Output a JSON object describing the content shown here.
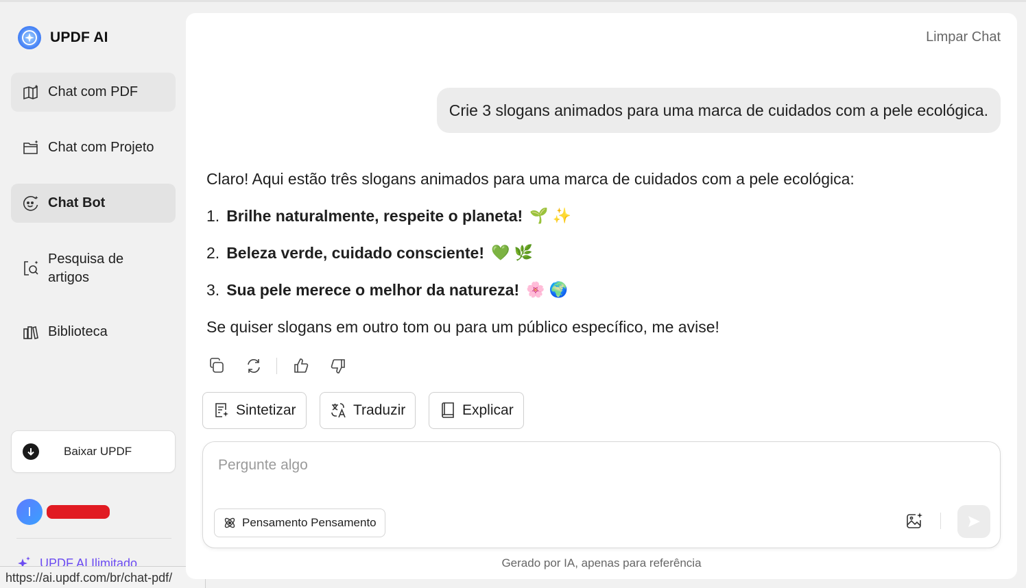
{
  "brand": {
    "name": "UPDF AI"
  },
  "sidebar": {
    "items": [
      {
        "label": "Chat com PDF",
        "icon": "book-sparkle-icon"
      },
      {
        "label": "Chat com Projeto",
        "icon": "folder-sparkle-icon"
      },
      {
        "label": "Chat Bot",
        "icon": "bot-face-icon"
      },
      {
        "label": "Pesquisa de",
        "label2": "artigos",
        "icon": "search-document-icon"
      },
      {
        "label": "Biblioteca",
        "icon": "library-icon"
      }
    ],
    "download_label": "Baixar UPDF",
    "user_initial": "I",
    "unlimited_label": "UPDF AI Ilimitado"
  },
  "status_url": "https://ai.updf.com/br/chat-pdf/",
  "chat": {
    "clear_label": "Limpar Chat",
    "user_message": "Crie 3 slogans animados para uma marca de cuidados com a pele ecológica.",
    "answer_intro": "Claro! Aqui estão três slogans animados para uma marca de cuidados com a pele ecológica:",
    "slogans": [
      {
        "num": "1.",
        "text": "Brilhe naturalmente, respeite o planeta!",
        "emoji": "🌱 ✨"
      },
      {
        "num": "2.",
        "text": "Beleza verde, cuidado consciente!",
        "emoji": "💚 🌿"
      },
      {
        "num": "3.",
        "text": "Sua pele merece o melhor da natureza!",
        "emoji": "🌸 🌍"
      }
    ],
    "answer_outro": "Se quiser slogans em outro tom ou para um público específico, me avise!"
  },
  "quick_actions": {
    "summarize": "Sintetizar",
    "translate": "Traduzir",
    "explain": "Explicar"
  },
  "input": {
    "placeholder": "Pergunte algo",
    "thinking_label": "Pensamento Pensamento"
  },
  "disclaimer": "Gerado por IA, apenas para referência",
  "colors": {
    "accent": "#6c4cf1",
    "background": "#f1f1f1",
    "redaction": "#e11b22"
  }
}
